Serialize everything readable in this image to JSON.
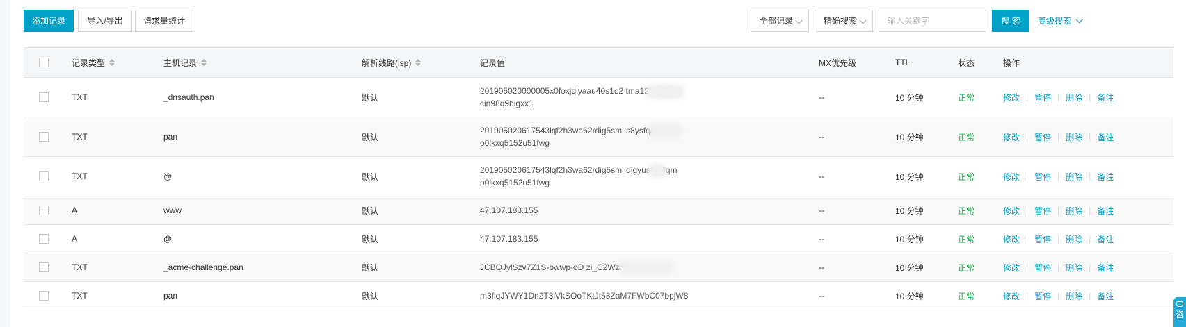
{
  "toolbar": {
    "add_record": "添加记录",
    "import_export": "导入/导出",
    "request_stats": "请求量统计",
    "filter_all": "全部记录",
    "filter_exact": "精确搜索",
    "search_placeholder": "输入关键字",
    "search_button": "搜 索",
    "advanced_search": "高级搜索"
  },
  "table": {
    "headers": {
      "type": "记录类型",
      "host": "主机记录",
      "line": "解析线路(isp)",
      "value": "记录值",
      "mx": "MX优先级",
      "ttl": "TTL",
      "status": "状态",
      "actions": "操作"
    },
    "action_labels": {
      "edit": "修改",
      "pause": "暂停",
      "delete": "删除",
      "note": "备注"
    },
    "rows": [
      {
        "type": "TXT",
        "host": "_dnsauth.pan",
        "line": "默认",
        "value": "201905020000005x0foxjqlyaau40s1o2          tma12ldxy1l\ncin98q9bigxx1",
        "mx": "--",
        "ttl": "10 分钟",
        "status": "正常"
      },
      {
        "type": "TXT",
        "host": "pan",
        "line": "默认",
        "value": "201905020617543lqf2h3wa62rdig5sml          s8ysfqm\no0lkxq5152u51fwg",
        "mx": "--",
        "ttl": "10 分钟",
        "status": "正常"
      },
      {
        "type": "TXT",
        "host": "@",
        "line": "默认",
        "value": "201905020617543lqf2h3wa62rdig5sml      dlgyus8ysfqm\no0lkxq5152u51fwg",
        "mx": "--",
        "ttl": "10 分钟",
        "status": "正常"
      },
      {
        "type": "A",
        "host": "www",
        "line": "默认",
        "value": "47.107.183.155",
        "mx": "--",
        "ttl": "10 分钟",
        "status": "正常"
      },
      {
        "type": "A",
        "host": "@",
        "line": "默认",
        "value": "47.107.183.155",
        "mx": "--",
        "ttl": "10 分钟",
        "status": "正常"
      },
      {
        "type": "TXT",
        "host": "_acme-challenge.pan",
        "line": "默认",
        "value": "JCBQJylSzv7Z1S-bwwp-oD                zi_C2Wzdk",
        "mx": "--",
        "ttl": "10 分钟",
        "status": "正常"
      },
      {
        "type": "TXT",
        "host": "pan",
        "line": "默认",
        "value": "m3fiqJYWY1Dn2T3lVkSOoTKtJt53ZaM7FWbC07bpjW8",
        "mx": "--",
        "ttl": "10 分钟",
        "status": "正常"
      }
    ]
  },
  "helper_tab": "咨",
  "colors": {
    "primary": "#00a2ca",
    "status_ok": "#1fae4b"
  }
}
